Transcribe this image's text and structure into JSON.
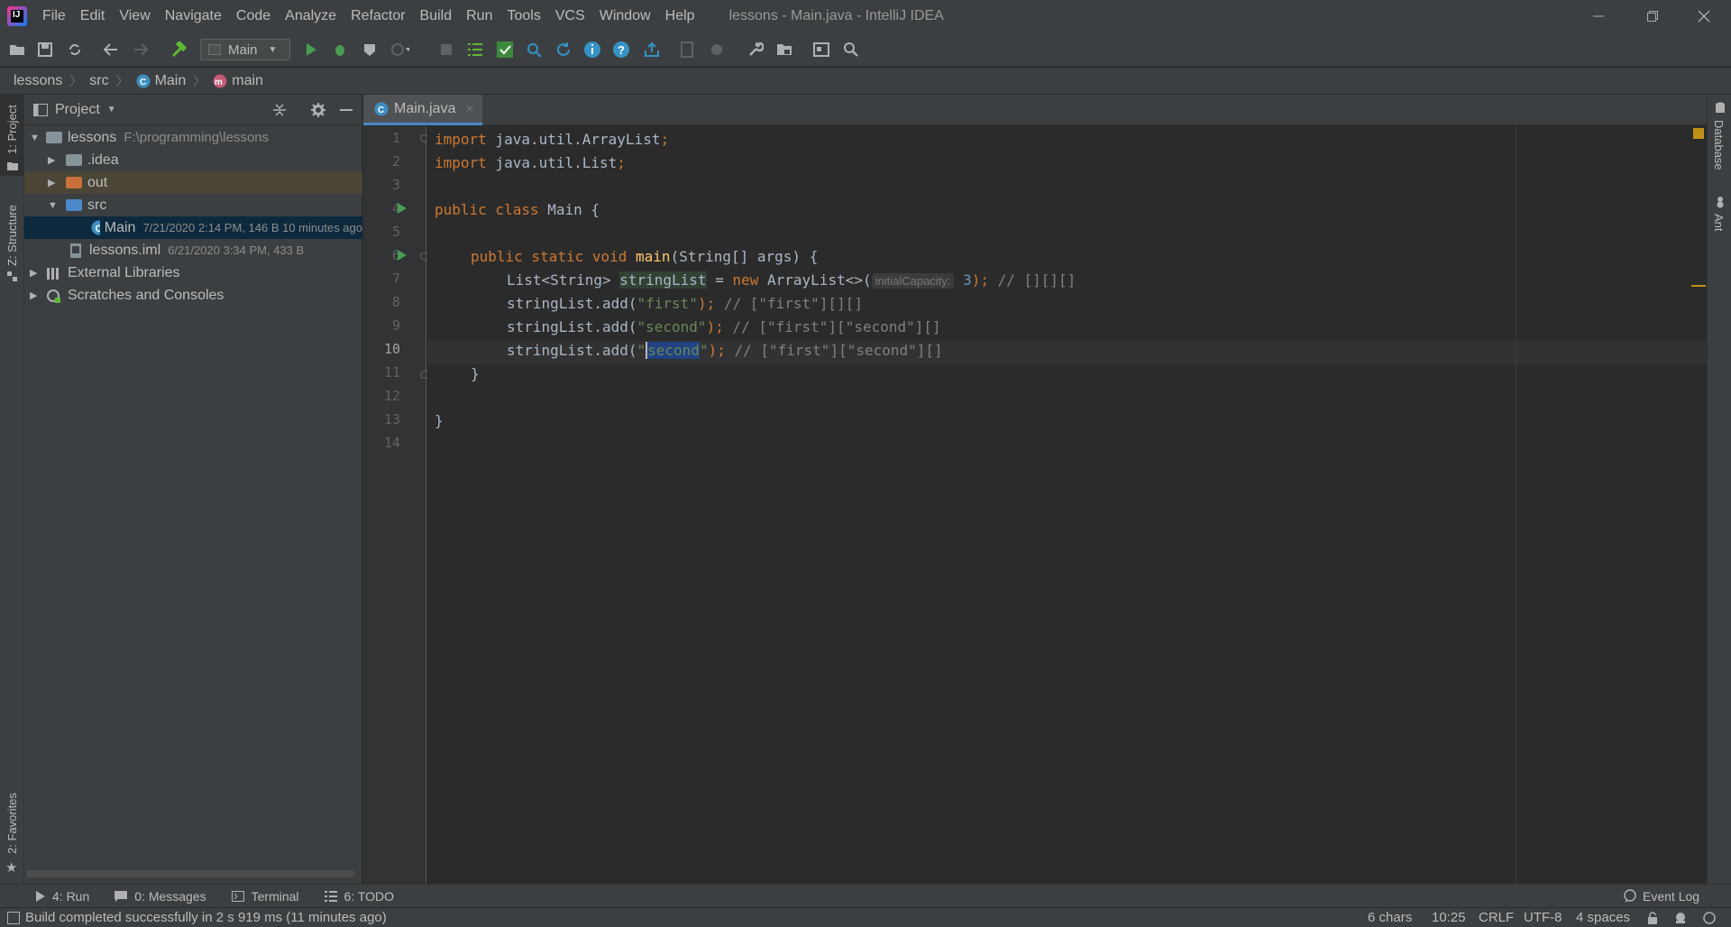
{
  "menubar": {
    "items": [
      "File",
      "Edit",
      "View",
      "Navigate",
      "Code",
      "Analyze",
      "Refactor",
      "Build",
      "Run",
      "Tools",
      "VCS",
      "Window",
      "Help"
    ],
    "title": "lessons - Main.java - IntelliJ IDEA"
  },
  "toolbar": {
    "run_config": "Main"
  },
  "breadcrumbs": {
    "project": "lessons",
    "folder": "src",
    "class": "Main",
    "method": "main"
  },
  "left_strip": {
    "project_label": "1: Project",
    "structure_label": "Z: Structure",
    "favorites_label": "2: Favorites"
  },
  "right_strip": {
    "database_label": "Database",
    "ant_label": "Ant"
  },
  "project_panel": {
    "title": "Project",
    "tree": {
      "root_name": "lessons",
      "root_path": "F:\\programming\\lessons",
      "idea": ".idea",
      "out": "out",
      "src": "src",
      "main_name": "Main",
      "main_meta": "7/21/2020 2:14 PM, 146 B 10 minutes ago",
      "iml_name": "lessons.iml",
      "iml_meta": "6/21/2020 3:34 PM, 433 B",
      "external": "External Libraries",
      "scratches": "Scratches and Consoles"
    }
  },
  "editor": {
    "tab_label": "Main.java",
    "line_numbers": [
      "1",
      "2",
      "3",
      "4",
      "5",
      "6",
      "7",
      "8",
      "9",
      "10",
      "11",
      "12",
      "13",
      "14"
    ],
    "code": {
      "l1_kw": "import",
      "l1_rest": " java.util.ArrayList",
      "l1_semi": ";",
      "l2_kw": "import",
      "l2_rest": " java.util.List",
      "l2_semi": ";",
      "l4_kw": "public class",
      "l4_rest": " Main {",
      "l6_kw": "public static void",
      "l6_fn": "main",
      "l6_rest": "(String[] args) {",
      "l7_a": "List<String> ",
      "l7_var": "stringList",
      "l7_b": " = ",
      "l7_new": "new",
      "l7_c": " ArrayList<>(",
      "l7_hint": "initialCapacity:",
      "l7_num": "3",
      "l7_d": ");",
      "l7_cm": " // [][][]",
      "l8_a": "stringList.add(",
      "l8_str": "\"first\"",
      "l8_b": ");",
      "l8_cm": " // [\"first\"][][]",
      "l9_a": "stringList.add(",
      "l9_str": "\"second\"",
      "l9_b": ");",
      "l9_cm": " // [\"first\"][\"second\"][]",
      "l10_a": "stringList.add(",
      "l10_q1": "\"",
      "l10_sel": "second",
      "l10_q2": "\"",
      "l10_b": ");",
      "l10_cm": " // [\"first\"][\"second\"][]",
      "l11": "}",
      "l13": "}"
    }
  },
  "bottom_tools": {
    "run": "4: Run",
    "messages": "0: Messages",
    "terminal": "Terminal",
    "todo": "6: TODO",
    "event_log": "Event Log"
  },
  "statusbar": {
    "message": "Build completed successfully in 2 s 919 ms (11 minutes ago)",
    "chars": "6 chars",
    "position": "10:25",
    "line_sep": "CRLF",
    "encoding": "UTF-8",
    "indent": "4 spaces"
  },
  "colors": {
    "background": "#2b2b2b",
    "panel": "#3c3f41",
    "keyword": "#cc7832",
    "string": "#6a8759",
    "function": "#ffc66d",
    "accent": "#4a88c7"
  }
}
